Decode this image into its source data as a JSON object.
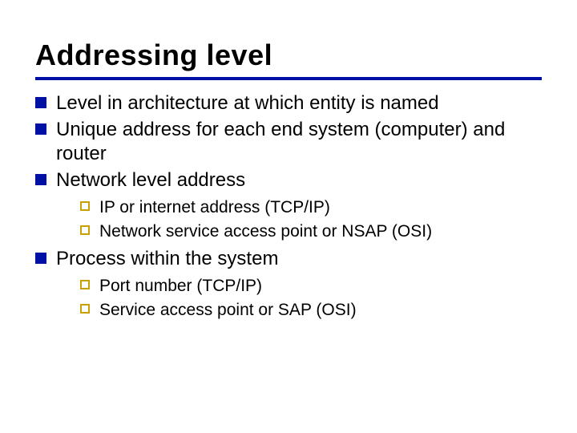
{
  "title": "Addressing level",
  "bullets": [
    {
      "text": "Level in architecture at which entity is named"
    },
    {
      "text": "Unique address for each end system (computer) and router"
    },
    {
      "text": "Network level address",
      "sub": [
        {
          "text": "IP or internet address (TCP/IP)"
        },
        {
          "text": "Network service access point or NSAP (OSI)"
        }
      ]
    },
    {
      "text": "Process within the system",
      "sub": [
        {
          "text": "Port number (TCP/IP)"
        },
        {
          "text": "Service access point or SAP (OSI)"
        }
      ]
    }
  ]
}
